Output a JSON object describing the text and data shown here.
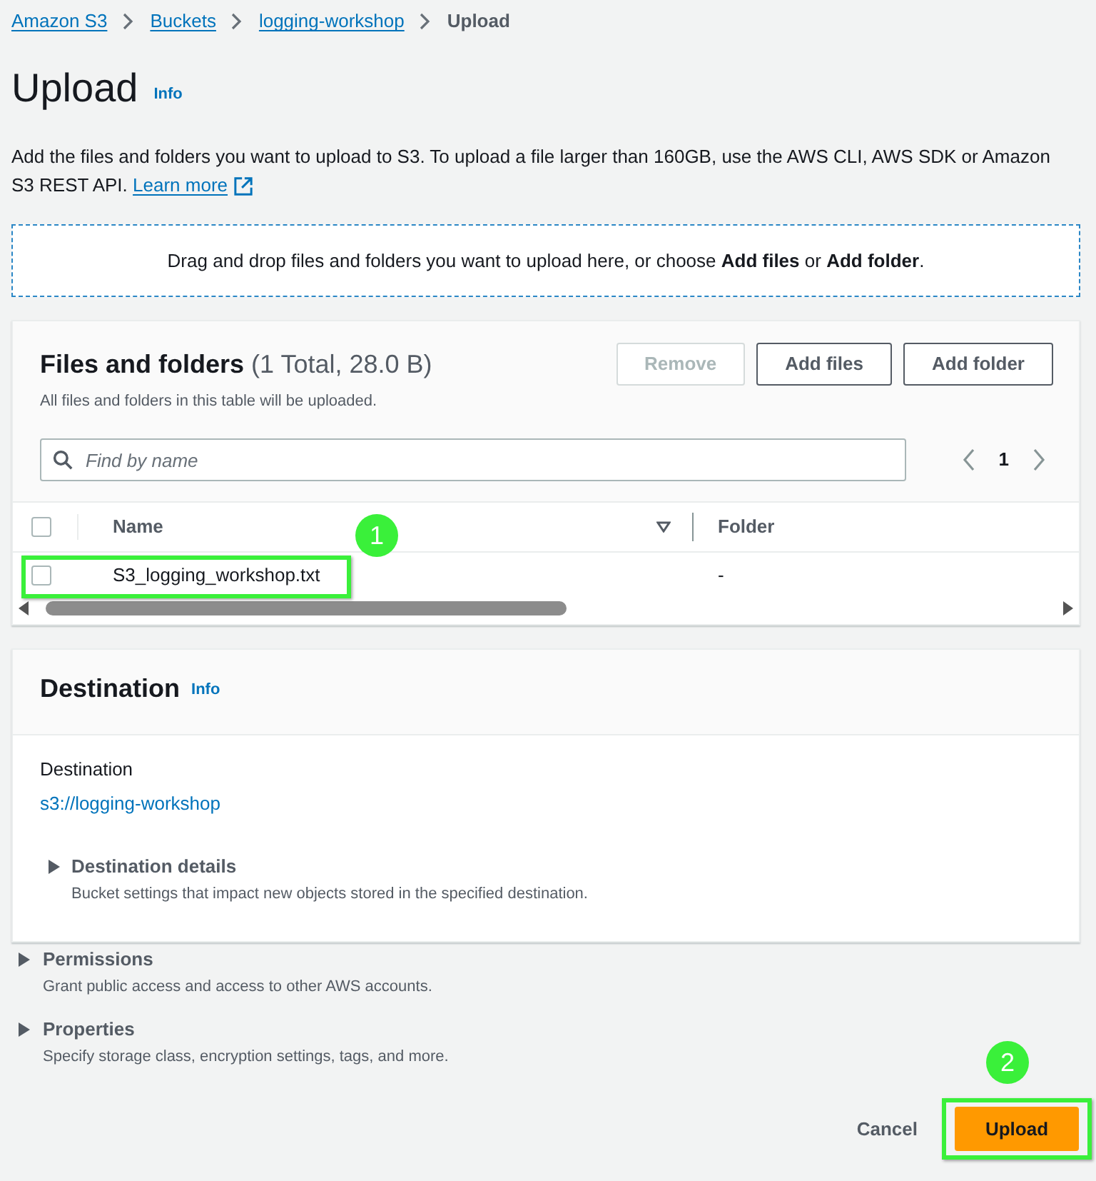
{
  "breadcrumbs": [
    {
      "label": "Amazon S3",
      "kind": "link"
    },
    {
      "label": "Buckets",
      "kind": "link"
    },
    {
      "label": "logging-workshop",
      "kind": "link"
    },
    {
      "label": "Upload",
      "kind": "current"
    }
  ],
  "page": {
    "title": "Upload",
    "info": "Info",
    "description": "Add the files and folders you want to upload to S3. To upload a file larger than 160GB, use the AWS CLI, AWS SDK or Amazon S3 REST API.",
    "learn_more": "Learn more"
  },
  "drop_zone": {
    "text": "Drag and drop files and folders you want to upload here, or choose **Add files** or **Add folder**."
  },
  "files_panel": {
    "title": "Files and folders",
    "count": "(1 Total, 28.0 B)",
    "subtitle": "All files and folders in this table will be uploaded.",
    "buttons": [
      {
        "label": "Remove",
        "disabled": true
      },
      {
        "label": "Add files",
        "disabled": false
      },
      {
        "label": "Add folder",
        "disabled": false
      }
    ],
    "search": {
      "placeholder": "Find by name"
    },
    "pagination": {
      "pages": [
        {
          "label": "1",
          "selected": true
        }
      ]
    },
    "table": {
      "select_all": {
        "checked": false
      },
      "columns": [
        {
          "label": "Name",
          "sortable": true
        },
        {
          "label": "Folder",
          "sortable": false
        }
      ],
      "rows": [
        {
          "name": "S3_logging_workshop.txt",
          "folder": "-",
          "checked": false,
          "highlighted": true,
          "callout": "1"
        }
      ]
    }
  },
  "destination_panel": {
    "title": "Destination",
    "info": "Info",
    "label": "Destination",
    "value": "s3://logging-workshop",
    "details": {
      "title": "Destination details",
      "description": "Bucket settings that impact new objects stored in the specified destination.",
      "expanded": false
    }
  },
  "sections": [
    {
      "title": "Permissions",
      "description": "Grant public access and access to other AWS accounts.",
      "expanded": false
    },
    {
      "title": "Properties",
      "description": "Specify storage class, encryption settings, tags, and more.",
      "expanded": false
    }
  ],
  "actions": [
    {
      "label": "Cancel",
      "kind": "link",
      "highlighted": false
    },
    {
      "label": "Upload",
      "kind": "primary",
      "highlighted": true,
      "callout": "2"
    }
  ]
}
